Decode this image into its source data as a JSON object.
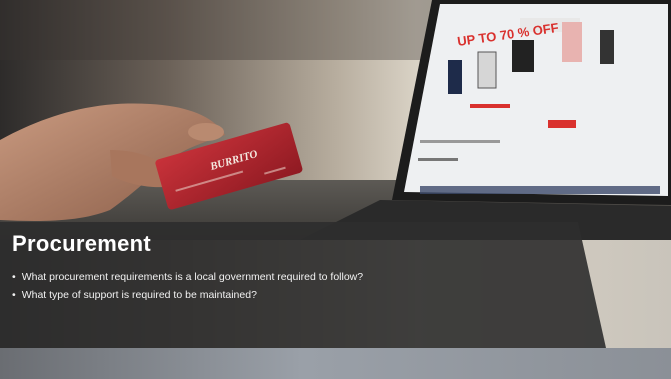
{
  "slide": {
    "title": "Procurement",
    "bullets": [
      "What procurement requirements is a local government required to follow?",
      "What type of support is required to be maintained?"
    ]
  },
  "photo": {
    "screen_banner": "UP TO 70 % OFF",
    "card_brand": "BURRITO"
  },
  "colors": {
    "card_red": "#b4232b",
    "sale_red": "#d9312e",
    "overlay": "#2e2e2e",
    "title_text": "#ffffff"
  }
}
